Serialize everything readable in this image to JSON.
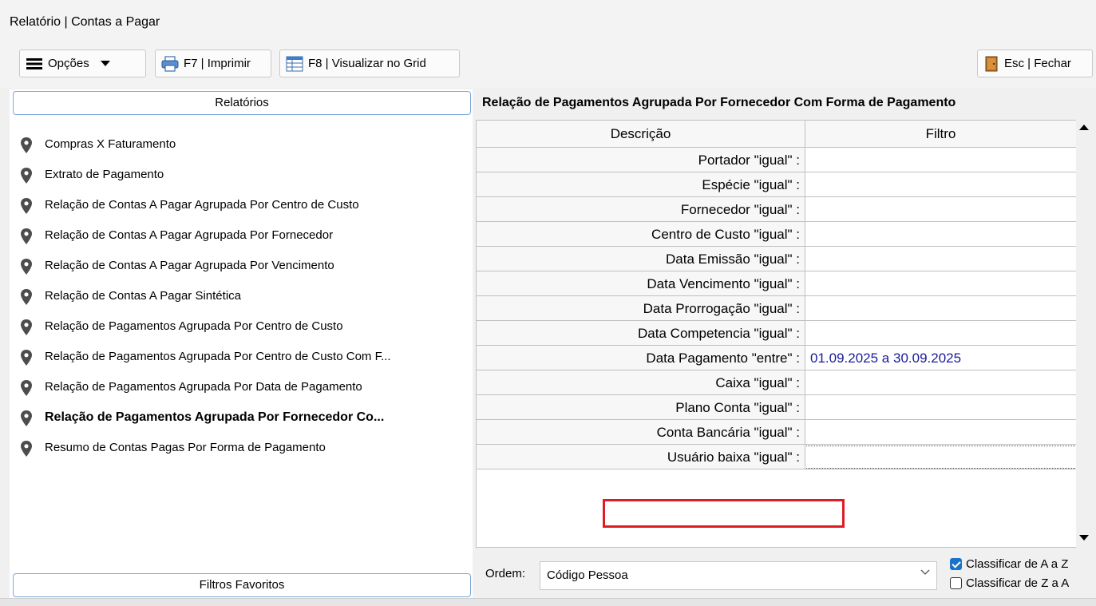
{
  "window": {
    "title": "Relatório | Contas a Pagar"
  },
  "toolbar": {
    "options_label": "Opções",
    "print_label": "F7 | Imprimir",
    "grid_label": "F8 | Visualizar no Grid",
    "close_label": "Esc | Fechar"
  },
  "left_panel": {
    "header": "Relatórios",
    "items": [
      {
        "label": "Compras X Faturamento"
      },
      {
        "label": "Extrato de Pagamento"
      },
      {
        "label": "Relação de Contas A Pagar Agrupada Por Centro de Custo"
      },
      {
        "label": "Relação de Contas A Pagar Agrupada Por Fornecedor"
      },
      {
        "label": "Relação de Contas A Pagar Agrupada Por Vencimento"
      },
      {
        "label": "Relação de Contas A Pagar Sintética"
      },
      {
        "label": "Relação de Pagamentos Agrupada Por Centro de Custo"
      },
      {
        "label": "Relação de Pagamentos Agrupada Por Centro de Custo Com F..."
      },
      {
        "label": "Relação de Pagamentos Agrupada Por Data de Pagamento"
      },
      {
        "label": "Relação de Pagamentos Agrupada Por Fornecedor Co...",
        "active": true
      },
      {
        "label": "Resumo de Contas Pagas Por Forma de Pagamento"
      }
    ],
    "footer": "Filtros Favoritos"
  },
  "right_panel": {
    "title": "Relação de Pagamentos Agrupada Por Fornecedor Com Forma de Pagamento",
    "grid": {
      "columns": [
        "Descrição",
        "Filtro"
      ],
      "rows": [
        {
          "desc": "Portador \"igual\" :",
          "filter": ""
        },
        {
          "desc": "Espécie \"igual\" :",
          "filter": ""
        },
        {
          "desc": "Fornecedor \"igual\" :",
          "filter": ""
        },
        {
          "desc": "Centro de Custo \"igual\" :",
          "filter": ""
        },
        {
          "desc": "Data Emissão \"igual\" :",
          "filter": ""
        },
        {
          "desc": "Data Vencimento \"igual\" :",
          "filter": ""
        },
        {
          "desc": "Data Prorrogação \"igual\" :",
          "filter": ""
        },
        {
          "desc": "Data Competencia \"igual\" :",
          "filter": ""
        },
        {
          "desc": "Data Pagamento \"entre\" :",
          "filter": "01.09.2025 a 30.09.2025"
        },
        {
          "desc": "Caixa \"igual\" :",
          "filter": ""
        },
        {
          "desc": "Plano Conta \"igual\" :",
          "filter": ""
        },
        {
          "desc": "Conta Bancária \"igual\" :",
          "filter": ""
        },
        {
          "desc": "Usuário baixa \"igual\" :",
          "filter": ""
        }
      ]
    },
    "order": {
      "label": "Ordem:",
      "value": "Código Pessoa"
    },
    "sort_asc_label": "Classificar de A a Z",
    "sort_asc_checked": true,
    "sort_desc_label": "Classificar de Z a A",
    "sort_desc_checked": false
  },
  "colors": {
    "highlight": "#e01b24",
    "filter_text": "#1a1a9c",
    "accent": "#1a73c8"
  }
}
